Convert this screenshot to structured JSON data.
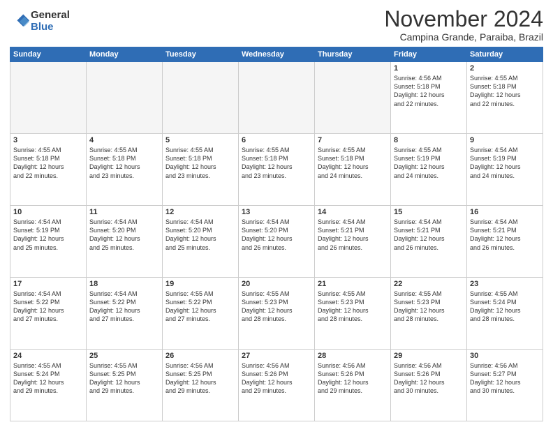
{
  "logo": {
    "general": "General",
    "blue": "Blue"
  },
  "header": {
    "month": "November 2024",
    "location": "Campina Grande, Paraiba, Brazil"
  },
  "weekdays": [
    "Sunday",
    "Monday",
    "Tuesday",
    "Wednesday",
    "Thursday",
    "Friday",
    "Saturday"
  ],
  "weeks": [
    [
      {
        "day": "",
        "info": ""
      },
      {
        "day": "",
        "info": ""
      },
      {
        "day": "",
        "info": ""
      },
      {
        "day": "",
        "info": ""
      },
      {
        "day": "",
        "info": ""
      },
      {
        "day": "1",
        "info": "Sunrise: 4:56 AM\nSunset: 5:18 PM\nDaylight: 12 hours\nand 22 minutes."
      },
      {
        "day": "2",
        "info": "Sunrise: 4:55 AM\nSunset: 5:18 PM\nDaylight: 12 hours\nand 22 minutes."
      }
    ],
    [
      {
        "day": "3",
        "info": "Sunrise: 4:55 AM\nSunset: 5:18 PM\nDaylight: 12 hours\nand 22 minutes."
      },
      {
        "day": "4",
        "info": "Sunrise: 4:55 AM\nSunset: 5:18 PM\nDaylight: 12 hours\nand 23 minutes."
      },
      {
        "day": "5",
        "info": "Sunrise: 4:55 AM\nSunset: 5:18 PM\nDaylight: 12 hours\nand 23 minutes."
      },
      {
        "day": "6",
        "info": "Sunrise: 4:55 AM\nSunset: 5:18 PM\nDaylight: 12 hours\nand 23 minutes."
      },
      {
        "day": "7",
        "info": "Sunrise: 4:55 AM\nSunset: 5:18 PM\nDaylight: 12 hours\nand 24 minutes."
      },
      {
        "day": "8",
        "info": "Sunrise: 4:55 AM\nSunset: 5:19 PM\nDaylight: 12 hours\nand 24 minutes."
      },
      {
        "day": "9",
        "info": "Sunrise: 4:54 AM\nSunset: 5:19 PM\nDaylight: 12 hours\nand 24 minutes."
      }
    ],
    [
      {
        "day": "10",
        "info": "Sunrise: 4:54 AM\nSunset: 5:19 PM\nDaylight: 12 hours\nand 25 minutes."
      },
      {
        "day": "11",
        "info": "Sunrise: 4:54 AM\nSunset: 5:20 PM\nDaylight: 12 hours\nand 25 minutes."
      },
      {
        "day": "12",
        "info": "Sunrise: 4:54 AM\nSunset: 5:20 PM\nDaylight: 12 hours\nand 25 minutes."
      },
      {
        "day": "13",
        "info": "Sunrise: 4:54 AM\nSunset: 5:20 PM\nDaylight: 12 hours\nand 26 minutes."
      },
      {
        "day": "14",
        "info": "Sunrise: 4:54 AM\nSunset: 5:21 PM\nDaylight: 12 hours\nand 26 minutes."
      },
      {
        "day": "15",
        "info": "Sunrise: 4:54 AM\nSunset: 5:21 PM\nDaylight: 12 hours\nand 26 minutes."
      },
      {
        "day": "16",
        "info": "Sunrise: 4:54 AM\nSunset: 5:21 PM\nDaylight: 12 hours\nand 26 minutes."
      }
    ],
    [
      {
        "day": "17",
        "info": "Sunrise: 4:54 AM\nSunset: 5:22 PM\nDaylight: 12 hours\nand 27 minutes."
      },
      {
        "day": "18",
        "info": "Sunrise: 4:54 AM\nSunset: 5:22 PM\nDaylight: 12 hours\nand 27 minutes."
      },
      {
        "day": "19",
        "info": "Sunrise: 4:55 AM\nSunset: 5:22 PM\nDaylight: 12 hours\nand 27 minutes."
      },
      {
        "day": "20",
        "info": "Sunrise: 4:55 AM\nSunset: 5:23 PM\nDaylight: 12 hours\nand 28 minutes."
      },
      {
        "day": "21",
        "info": "Sunrise: 4:55 AM\nSunset: 5:23 PM\nDaylight: 12 hours\nand 28 minutes."
      },
      {
        "day": "22",
        "info": "Sunrise: 4:55 AM\nSunset: 5:23 PM\nDaylight: 12 hours\nand 28 minutes."
      },
      {
        "day": "23",
        "info": "Sunrise: 4:55 AM\nSunset: 5:24 PM\nDaylight: 12 hours\nand 28 minutes."
      }
    ],
    [
      {
        "day": "24",
        "info": "Sunrise: 4:55 AM\nSunset: 5:24 PM\nDaylight: 12 hours\nand 29 minutes."
      },
      {
        "day": "25",
        "info": "Sunrise: 4:55 AM\nSunset: 5:25 PM\nDaylight: 12 hours\nand 29 minutes."
      },
      {
        "day": "26",
        "info": "Sunrise: 4:56 AM\nSunset: 5:25 PM\nDaylight: 12 hours\nand 29 minutes."
      },
      {
        "day": "27",
        "info": "Sunrise: 4:56 AM\nSunset: 5:26 PM\nDaylight: 12 hours\nand 29 minutes."
      },
      {
        "day": "28",
        "info": "Sunrise: 4:56 AM\nSunset: 5:26 PM\nDaylight: 12 hours\nand 29 minutes."
      },
      {
        "day": "29",
        "info": "Sunrise: 4:56 AM\nSunset: 5:26 PM\nDaylight: 12 hours\nand 30 minutes."
      },
      {
        "day": "30",
        "info": "Sunrise: 4:56 AM\nSunset: 5:27 PM\nDaylight: 12 hours\nand 30 minutes."
      }
    ]
  ]
}
